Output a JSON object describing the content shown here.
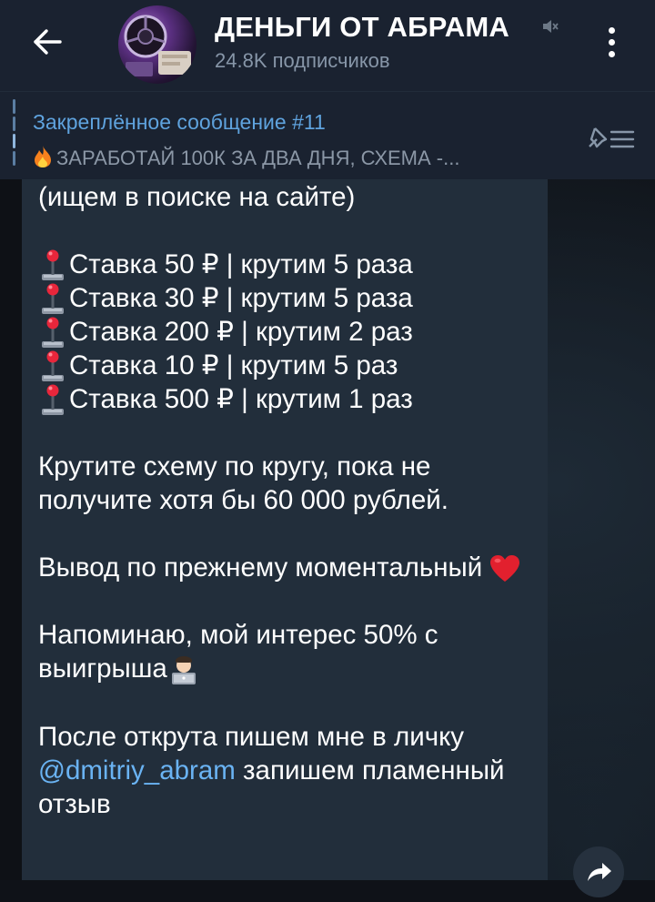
{
  "header": {
    "title": "ДЕНЬГИ ОТ АБРАМА",
    "subscribers": "24.8K подписчиков"
  },
  "pinned": {
    "title": "Закреплённое сообщение #11",
    "text": "ЗАРАБОТАЙ 100К ЗА ДВА ДНЯ, СХЕМА -..."
  },
  "message": {
    "line_search": "(ищем в поиске на сайте)",
    "stakes": [
      "Ставка 50 ₽ | крутим 5 раза",
      "Ставка 30 ₽ | крутим 5 раза",
      "Ставка 200 ₽ | крутим 2 раз",
      "Ставка 10 ₽ | крутим 5 раз",
      "Ставка 500 ₽ | крутим 1 раз"
    ],
    "para_loop": "Крутите схему по кругу, пока не получите хотя бы 60 000 рублей.",
    "para_withdraw": "Вывод по прежнему моментальный",
    "para_interest": "Напоминаю, мой интерес 50% с выигрыша",
    "para_after_prefix": "После открута пишем мне в личку",
    "mention": "@dmitriy_abram",
    "para_after_suffix": "запишем пламенный отзыв"
  },
  "icons": {
    "back": "arrow-left-icon",
    "mute": "muted-speaker-icon",
    "menu": "more-vertical-icon",
    "pin_list": "pin-list-icon",
    "joystick": "joystick-emoji",
    "heart": "red-heart-emoji",
    "technologist": "technologist-emoji",
    "fire": "fire-emoji",
    "share": "share-arrow-icon"
  },
  "colors": {
    "header_bg": "#1a2230",
    "bubble_bg": "#222e3b",
    "accent_link": "#6ab3f3",
    "pinned_title": "#5fa3de",
    "secondary_text": "#8796a8"
  }
}
